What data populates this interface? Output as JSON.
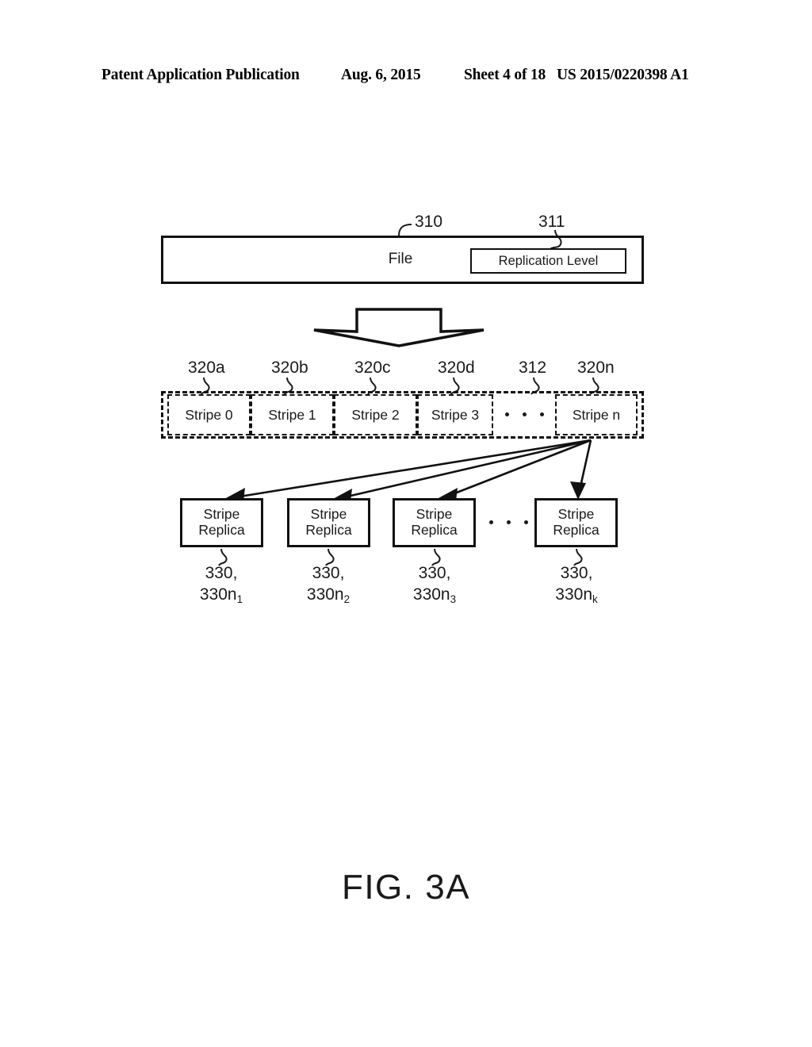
{
  "header": {
    "publication": "Patent Application Publication",
    "date": "Aug. 6, 2015",
    "sheet": "Sheet 4 of 18",
    "number": "US 2015/0220398 A1"
  },
  "figure": {
    "caption": "FIG. 3A",
    "file": {
      "label": "File",
      "ref": "310",
      "replication_level": {
        "label": "Replication Level",
        "ref": "311"
      }
    },
    "stripes": {
      "container_ref": "312",
      "items": [
        {
          "label": "Stripe 0",
          "ref": "320a"
        },
        {
          "label": "Stripe 1",
          "ref": "320b"
        },
        {
          "label": "Stripe 2",
          "ref": "320c"
        },
        {
          "label": "Stripe 3",
          "ref": "320d"
        },
        {
          "label": "Stripe n",
          "ref": "320n"
        }
      ],
      "ellipsis": "• • •"
    },
    "replicas": {
      "items": [
        {
          "line1": "Stripe",
          "line2": "Replica",
          "ref_line1": "330,",
          "ref_line2": "330n",
          "ref_sub": "1"
        },
        {
          "line1": "Stripe",
          "line2": "Replica",
          "ref_line1": "330,",
          "ref_line2": "330n",
          "ref_sub": "2"
        },
        {
          "line1": "Stripe",
          "line2": "Replica",
          "ref_line1": "330,",
          "ref_line2": "330n",
          "ref_sub": "3"
        },
        {
          "line1": "Stripe",
          "line2": "Replica",
          "ref_line1": "330,",
          "ref_line2": "330n",
          "ref_sub": "k"
        }
      ],
      "ellipsis": "• • •"
    }
  },
  "colors": {
    "ink": "#1a1a1a",
    "line": "#111111",
    "background": "#ffffff"
  }
}
